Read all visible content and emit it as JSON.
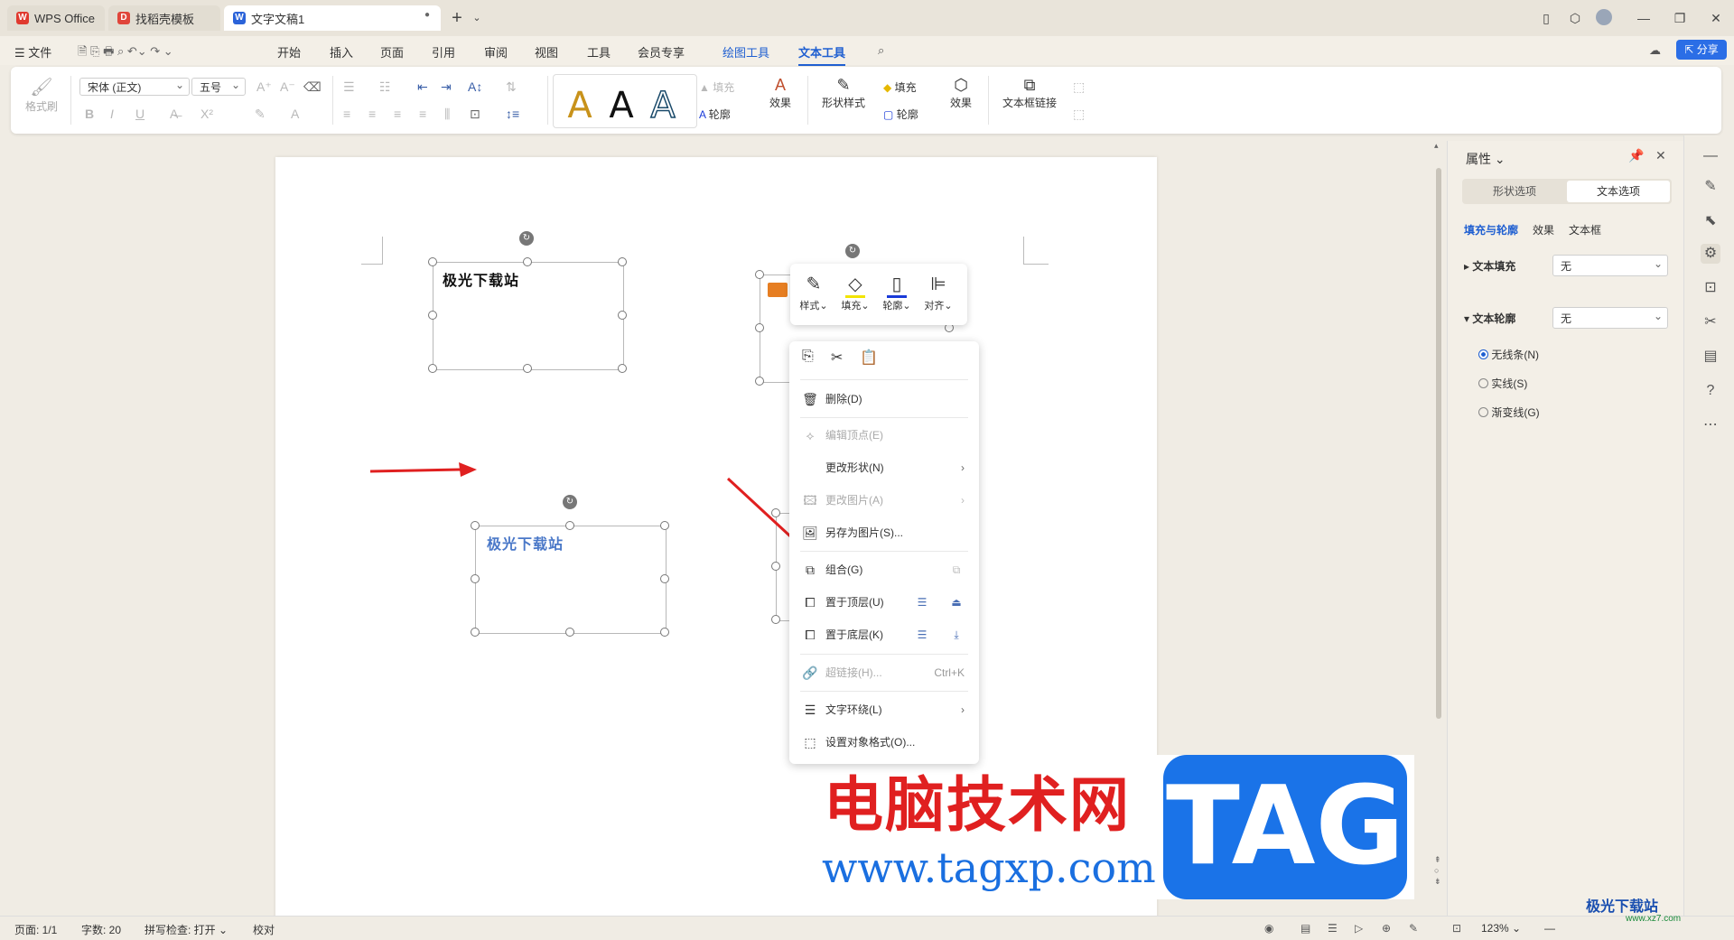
{
  "tabs": [
    {
      "label": "WPS Office",
      "active": false
    },
    {
      "label": "找稻壳模板",
      "active": false
    },
    {
      "label": "文字文稿1",
      "active": true
    }
  ],
  "menubar": {
    "file": "文件",
    "items": [
      "开始",
      "插入",
      "页面",
      "引用",
      "审阅",
      "视图",
      "工具",
      "会员专享"
    ],
    "tools": [
      "绘图工具",
      "文本工具"
    ],
    "share": "分享"
  },
  "ribbon": {
    "format_painter": "格式刷",
    "font_name": "宋体 (正文)",
    "font_size": "五号",
    "text_fill": "填充",
    "text_outline": "轮廓",
    "text_effect": "效果",
    "shape_style": "形状样式",
    "shape_fill": "填充",
    "shape_outline": "轮廓",
    "shape_effect": "效果",
    "textbox_link": "文本框链接",
    "preview_letter": "A"
  },
  "document": {
    "box1_text": "极光下载站",
    "box2_text": "极光下载站"
  },
  "mini_toolbar": [
    "样式",
    "填充",
    "轮廓",
    "对齐"
  ],
  "context_menu": {
    "delete": "删除(D)",
    "edit_points": "编辑顶点(E)",
    "change_shape": "更改形状(N)",
    "change_picture": "更改图片(A)",
    "save_as_picture": "另存为图片(S)...",
    "group": "组合(G)",
    "bring_to_front": "置于顶层(U)",
    "send_to_back": "置于底层(K)",
    "hyperlink": "超链接(H)...",
    "hyperlink_shortcut": "Ctrl+K",
    "text_wrap": "文字环绕(L)",
    "format_object": "设置对象格式(O)..."
  },
  "panel": {
    "title": "属性",
    "tab_shape": "形状选项",
    "tab_text": "文本选项",
    "subtabs": [
      "填充与轮廓",
      "效果",
      "文本框"
    ],
    "text_fill_label": "文本填充",
    "text_fill_value": "无",
    "text_outline_label": "文本轮廓",
    "text_outline_value": "无",
    "radios": [
      {
        "label": "无线条(N)",
        "checked": true
      },
      {
        "label": "实线(S)",
        "checked": false
      },
      {
        "label": "渐变线(G)",
        "checked": false
      }
    ]
  },
  "statusbar": {
    "page": "页面: 1/1",
    "words": "字数: 20",
    "spell": "拼写检查: 打开",
    "proof": "校对",
    "zoom": "123%"
  },
  "watermark": {
    "cn": "电脑技术网",
    "url": "www.tagxp.com",
    "tag": "TAG",
    "corner": "极光下载站",
    "corner_url": "www.xz7.com"
  },
  "colors": {
    "accent": "#1f5fd1",
    "arrow": "#e02020",
    "tag_blue": "#1a73e8"
  }
}
